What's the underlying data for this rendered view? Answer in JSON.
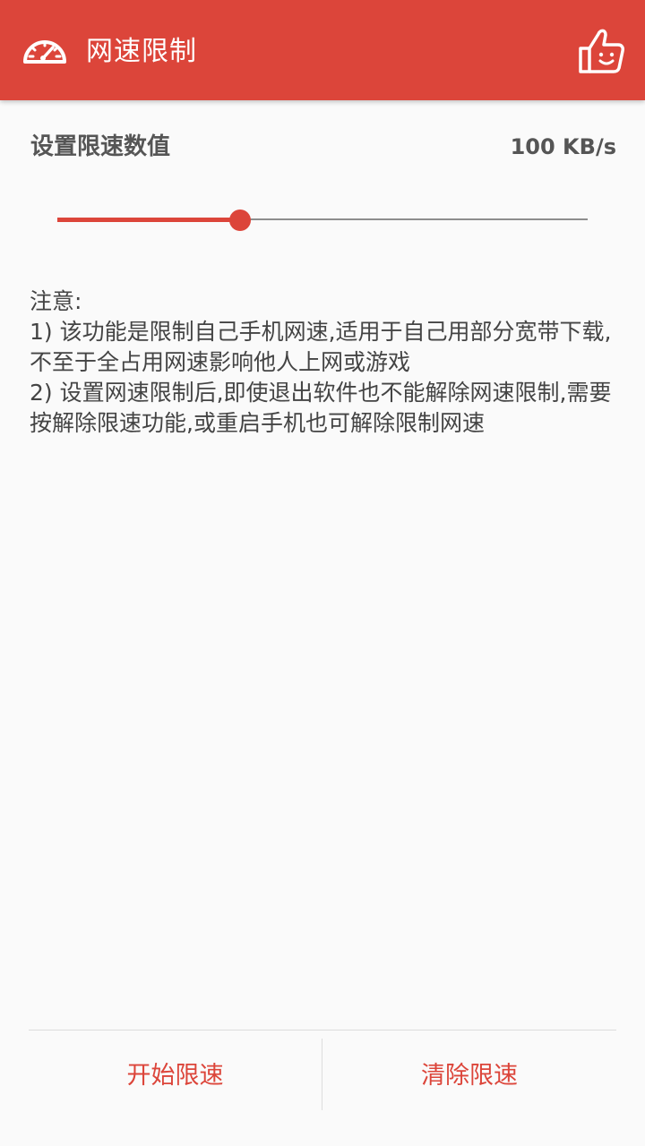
{
  "toolbar": {
    "title": "网速限制",
    "left_icon": "speedometer-icon",
    "right_icon": "thumbs-up-icon"
  },
  "setting": {
    "label": "设置限速数值",
    "value": "100 KB/s",
    "slider_level_percent": 34.5
  },
  "notice": {
    "heading": "注意:",
    "item1": "1) 该功能是限制自己手机网速,适用于自己用部分宽带下载,不至于全占用网速影响他人上网或游戏",
    "item2": "2) 设置网速限制后,即使退出软件也不能解除网速限制,需要按解除限速功能,或重启手机也可解除限制网速"
  },
  "actions": {
    "start_label": "开始限速",
    "clear_label": "清除限速"
  },
  "colors": {
    "accent": "#dc453a",
    "background": "#fafafa",
    "text": "#444444"
  }
}
